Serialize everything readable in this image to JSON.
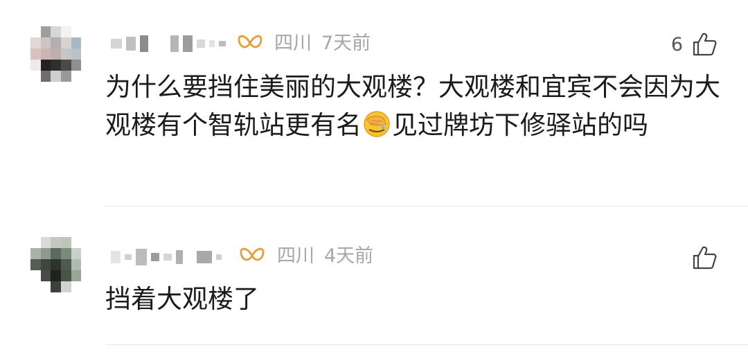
{
  "comments": [
    {
      "region": "四川",
      "time": "7天前",
      "like_count": "6",
      "text_before_emoji": "为什么要挡住美丽的大观楼？大观楼和宜宾不会因为大观楼有个智轨站更有名",
      "emoji": "facepalm-emoji",
      "text_after_emoji": "见过牌坊下修驿站的吗"
    },
    {
      "region": "四川",
      "time": "4天前",
      "like_count": "",
      "text_before_emoji": "挡着大观楼了",
      "emoji": "",
      "text_after_emoji": ""
    }
  ],
  "colors": {
    "meta_text": "#a6a6a6",
    "vip_badge": "#e0a443",
    "divider": "#e8e8e8"
  }
}
